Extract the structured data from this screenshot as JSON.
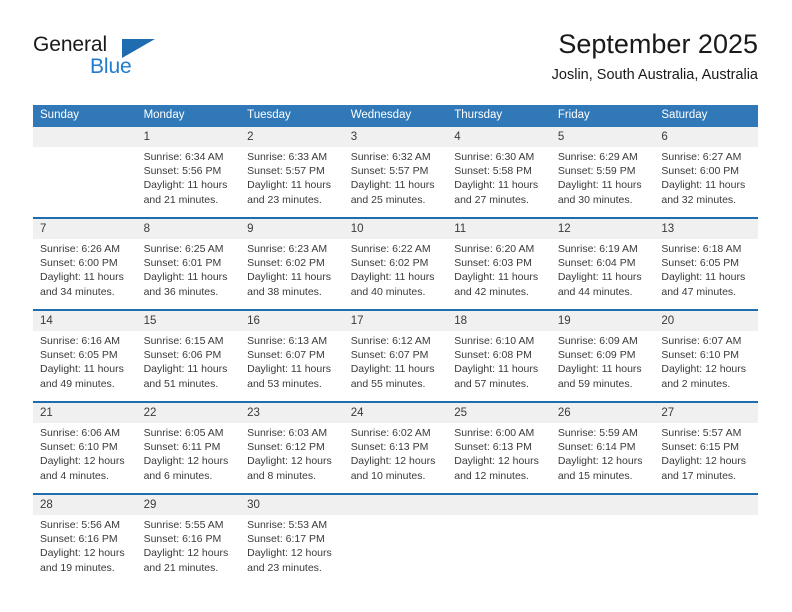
{
  "brand": {
    "name_part1": "General",
    "name_part2": "Blue",
    "triangle_color": "#1f6cb0",
    "blue_color": "#1f7ccf"
  },
  "header": {
    "title": "September 2025",
    "subtitle": "Joslin, South Australia, Australia"
  },
  "theme": {
    "header_blue": "#3178b8",
    "rule_blue": "#1f6cb0",
    "daynum_band": "#f0f0f0",
    "text": "#3a3a3a"
  },
  "weekday_headers": [
    "Sunday",
    "Monday",
    "Tuesday",
    "Wednesday",
    "Thursday",
    "Friday",
    "Saturday"
  ],
  "weeks": [
    {
      "days": [
        {
          "num": "",
          "sunrise": "",
          "sunset": "",
          "daylight_1": "",
          "daylight_2": "",
          "empty": true
        },
        {
          "num": "1",
          "sunrise": "Sunrise: 6:34 AM",
          "sunset": "Sunset: 5:56 PM",
          "daylight_1": "Daylight: 11 hours",
          "daylight_2": "and 21 minutes."
        },
        {
          "num": "2",
          "sunrise": "Sunrise: 6:33 AM",
          "sunset": "Sunset: 5:57 PM",
          "daylight_1": "Daylight: 11 hours",
          "daylight_2": "and 23 minutes."
        },
        {
          "num": "3",
          "sunrise": "Sunrise: 6:32 AM",
          "sunset": "Sunset: 5:57 PM",
          "daylight_1": "Daylight: 11 hours",
          "daylight_2": "and 25 minutes."
        },
        {
          "num": "4",
          "sunrise": "Sunrise: 6:30 AM",
          "sunset": "Sunset: 5:58 PM",
          "daylight_1": "Daylight: 11 hours",
          "daylight_2": "and 27 minutes."
        },
        {
          "num": "5",
          "sunrise": "Sunrise: 6:29 AM",
          "sunset": "Sunset: 5:59 PM",
          "daylight_1": "Daylight: 11 hours",
          "daylight_2": "and 30 minutes."
        },
        {
          "num": "6",
          "sunrise": "Sunrise: 6:27 AM",
          "sunset": "Sunset: 6:00 PM",
          "daylight_1": "Daylight: 11 hours",
          "daylight_2": "and 32 minutes."
        }
      ]
    },
    {
      "days": [
        {
          "num": "7",
          "sunrise": "Sunrise: 6:26 AM",
          "sunset": "Sunset: 6:00 PM",
          "daylight_1": "Daylight: 11 hours",
          "daylight_2": "and 34 minutes."
        },
        {
          "num": "8",
          "sunrise": "Sunrise: 6:25 AM",
          "sunset": "Sunset: 6:01 PM",
          "daylight_1": "Daylight: 11 hours",
          "daylight_2": "and 36 minutes."
        },
        {
          "num": "9",
          "sunrise": "Sunrise: 6:23 AM",
          "sunset": "Sunset: 6:02 PM",
          "daylight_1": "Daylight: 11 hours",
          "daylight_2": "and 38 minutes."
        },
        {
          "num": "10",
          "sunrise": "Sunrise: 6:22 AM",
          "sunset": "Sunset: 6:02 PM",
          "daylight_1": "Daylight: 11 hours",
          "daylight_2": "and 40 minutes."
        },
        {
          "num": "11",
          "sunrise": "Sunrise: 6:20 AM",
          "sunset": "Sunset: 6:03 PM",
          "daylight_1": "Daylight: 11 hours",
          "daylight_2": "and 42 minutes."
        },
        {
          "num": "12",
          "sunrise": "Sunrise: 6:19 AM",
          "sunset": "Sunset: 6:04 PM",
          "daylight_1": "Daylight: 11 hours",
          "daylight_2": "and 44 minutes."
        },
        {
          "num": "13",
          "sunrise": "Sunrise: 6:18 AM",
          "sunset": "Sunset: 6:05 PM",
          "daylight_1": "Daylight: 11 hours",
          "daylight_2": "and 47 minutes."
        }
      ]
    },
    {
      "days": [
        {
          "num": "14",
          "sunrise": "Sunrise: 6:16 AM",
          "sunset": "Sunset: 6:05 PM",
          "daylight_1": "Daylight: 11 hours",
          "daylight_2": "and 49 minutes."
        },
        {
          "num": "15",
          "sunrise": "Sunrise: 6:15 AM",
          "sunset": "Sunset: 6:06 PM",
          "daylight_1": "Daylight: 11 hours",
          "daylight_2": "and 51 minutes."
        },
        {
          "num": "16",
          "sunrise": "Sunrise: 6:13 AM",
          "sunset": "Sunset: 6:07 PM",
          "daylight_1": "Daylight: 11 hours",
          "daylight_2": "and 53 minutes."
        },
        {
          "num": "17",
          "sunrise": "Sunrise: 6:12 AM",
          "sunset": "Sunset: 6:07 PM",
          "daylight_1": "Daylight: 11 hours",
          "daylight_2": "and 55 minutes."
        },
        {
          "num": "18",
          "sunrise": "Sunrise: 6:10 AM",
          "sunset": "Sunset: 6:08 PM",
          "daylight_1": "Daylight: 11 hours",
          "daylight_2": "and 57 minutes."
        },
        {
          "num": "19",
          "sunrise": "Sunrise: 6:09 AM",
          "sunset": "Sunset: 6:09 PM",
          "daylight_1": "Daylight: 11 hours",
          "daylight_2": "and 59 minutes."
        },
        {
          "num": "20",
          "sunrise": "Sunrise: 6:07 AM",
          "sunset": "Sunset: 6:10 PM",
          "daylight_1": "Daylight: 12 hours",
          "daylight_2": "and 2 minutes."
        }
      ]
    },
    {
      "days": [
        {
          "num": "21",
          "sunrise": "Sunrise: 6:06 AM",
          "sunset": "Sunset: 6:10 PM",
          "daylight_1": "Daylight: 12 hours",
          "daylight_2": "and 4 minutes."
        },
        {
          "num": "22",
          "sunrise": "Sunrise: 6:05 AM",
          "sunset": "Sunset: 6:11 PM",
          "daylight_1": "Daylight: 12 hours",
          "daylight_2": "and 6 minutes."
        },
        {
          "num": "23",
          "sunrise": "Sunrise: 6:03 AM",
          "sunset": "Sunset: 6:12 PM",
          "daylight_1": "Daylight: 12 hours",
          "daylight_2": "and 8 minutes."
        },
        {
          "num": "24",
          "sunrise": "Sunrise: 6:02 AM",
          "sunset": "Sunset: 6:13 PM",
          "daylight_1": "Daylight: 12 hours",
          "daylight_2": "and 10 minutes."
        },
        {
          "num": "25",
          "sunrise": "Sunrise: 6:00 AM",
          "sunset": "Sunset: 6:13 PM",
          "daylight_1": "Daylight: 12 hours",
          "daylight_2": "and 12 minutes."
        },
        {
          "num": "26",
          "sunrise": "Sunrise: 5:59 AM",
          "sunset": "Sunset: 6:14 PM",
          "daylight_1": "Daylight: 12 hours",
          "daylight_2": "and 15 minutes."
        },
        {
          "num": "27",
          "sunrise": "Sunrise: 5:57 AM",
          "sunset": "Sunset: 6:15 PM",
          "daylight_1": "Daylight: 12 hours",
          "daylight_2": "and 17 minutes."
        }
      ]
    },
    {
      "days": [
        {
          "num": "28",
          "sunrise": "Sunrise: 5:56 AM",
          "sunset": "Sunset: 6:16 PM",
          "daylight_1": "Daylight: 12 hours",
          "daylight_2": "and 19 minutes."
        },
        {
          "num": "29",
          "sunrise": "Sunrise: 5:55 AM",
          "sunset": "Sunset: 6:16 PM",
          "daylight_1": "Daylight: 12 hours",
          "daylight_2": "and 21 minutes."
        },
        {
          "num": "30",
          "sunrise": "Sunrise: 5:53 AM",
          "sunset": "Sunset: 6:17 PM",
          "daylight_1": "Daylight: 12 hours",
          "daylight_2": "and 23 minutes."
        },
        {
          "num": "",
          "sunrise": "",
          "sunset": "",
          "daylight_1": "",
          "daylight_2": "",
          "empty": true
        },
        {
          "num": "",
          "sunrise": "",
          "sunset": "",
          "daylight_1": "",
          "daylight_2": "",
          "empty": true
        },
        {
          "num": "",
          "sunrise": "",
          "sunset": "",
          "daylight_1": "",
          "daylight_2": "",
          "empty": true
        },
        {
          "num": "",
          "sunrise": "",
          "sunset": "",
          "daylight_1": "",
          "daylight_2": "",
          "empty": true
        }
      ]
    }
  ]
}
